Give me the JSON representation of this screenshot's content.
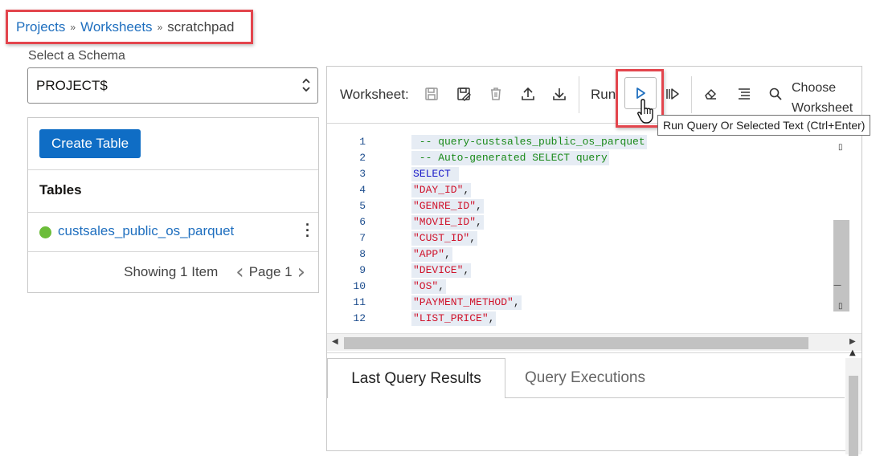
{
  "breadcrumb": {
    "projects": "Projects",
    "worksheets": "Worksheets",
    "current": "scratchpad",
    "separator": "»"
  },
  "schema": {
    "label": "Select a Schema",
    "selected": "PROJECT$"
  },
  "tables_panel": {
    "create_button": "Create Table",
    "heading": "Tables",
    "items": [
      {
        "name": "custsales_public_os_parquet",
        "status_color": "#6cbd3a"
      }
    ],
    "pager": {
      "showing": "Showing 1 Item",
      "page": "Page 1"
    }
  },
  "worksheet": {
    "label": "Worksheet:",
    "run_label": "Run",
    "choose_line1": "Choose",
    "choose_line2": "Worksheet",
    "tooltip": "Run Query Or Selected Text (Ctrl+Enter)",
    "toolbar_icons": [
      "save-icon",
      "save-as-icon",
      "delete-icon",
      "upload-icon",
      "download-icon",
      "run-icon",
      "run-script-icon",
      "eraser-icon",
      "format-icon",
      "search-icon"
    ]
  },
  "editor": {
    "lines": [
      {
        "n": "1",
        "text": " -- query-custsales_public_os_parquet",
        "kind": "comment"
      },
      {
        "n": "2",
        "text": " -- Auto-generated SELECT query",
        "kind": "comment"
      },
      {
        "n": "3",
        "text": "SELECT ",
        "kind": "kw"
      },
      {
        "n": "4",
        "text": "\"DAY_ID\"",
        "kind": "str"
      },
      {
        "n": "5",
        "text": "\"GENRE_ID\"",
        "kind": "str"
      },
      {
        "n": "6",
        "text": "\"MOVIE_ID\"",
        "kind": "str"
      },
      {
        "n": "7",
        "text": "\"CUST_ID\"",
        "kind": "str"
      },
      {
        "n": "8",
        "text": "\"APP\"",
        "kind": "str"
      },
      {
        "n": "9",
        "text": "\"DEVICE\"",
        "kind": "str"
      },
      {
        "n": "10",
        "text": "\"OS\"",
        "kind": "str"
      },
      {
        "n": "11",
        "text": "\"PAYMENT_METHOD\"",
        "kind": "str"
      },
      {
        "n": "12",
        "text": "\"LIST_PRICE\"",
        "kind": "str"
      }
    ]
  },
  "results": {
    "tab_last": "Last Query Results",
    "tab_exec": "Query Executions"
  },
  "colors": {
    "accent": "#0f6dc5",
    "highlight": "#e3454d",
    "link": "#1f6fbf",
    "string": "#d0142c",
    "comment": "#1a8a1a",
    "keyword": "#1a1ac8"
  }
}
